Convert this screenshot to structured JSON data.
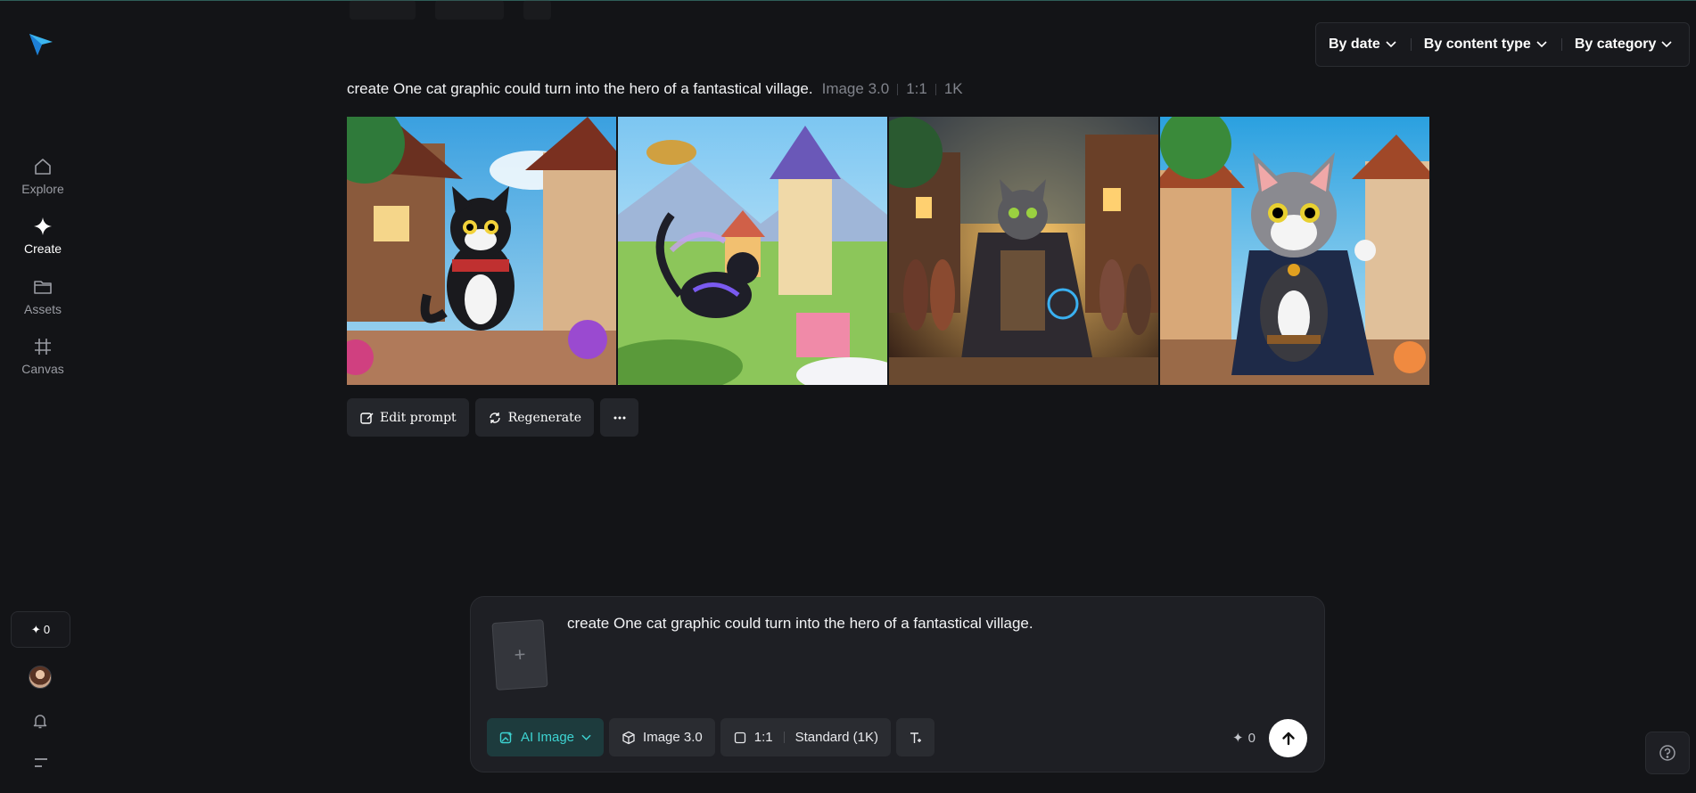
{
  "sidebar": {
    "items": [
      {
        "label": "Explore",
        "icon": "home-icon"
      },
      {
        "label": "Create",
        "icon": "sparkle-icon"
      },
      {
        "label": "Assets",
        "icon": "folder-icon"
      },
      {
        "label": "Canvas",
        "icon": "frame-icon"
      }
    ],
    "credits": "0"
  },
  "filters": [
    {
      "label": "By date"
    },
    {
      "label": "By content type"
    },
    {
      "label": "By category"
    }
  ],
  "generation": {
    "prompt": "create One cat graphic could turn into the hero of a fantastical village.",
    "model": "Image 3.0",
    "ratio": "1:1",
    "resolution": "1K"
  },
  "actions": {
    "edit_prompt": "Edit prompt",
    "regenerate": "Regenerate"
  },
  "composer": {
    "text": "create One cat graphic could turn into the hero of a fantastical village.",
    "mode": "AI Image",
    "model": "Image 3.0",
    "ratio": "1:1",
    "quality": "Standard (1K)",
    "cost": "0"
  },
  "colors": {
    "accent": "#3dd3d1",
    "background": "#131417"
  }
}
